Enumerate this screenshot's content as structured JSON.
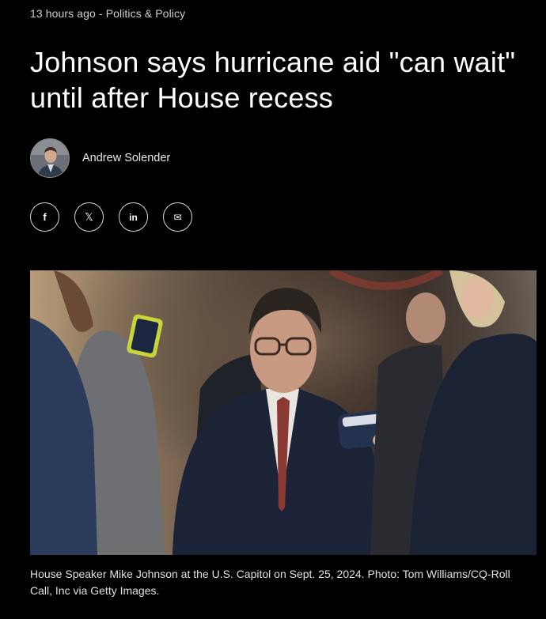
{
  "article": {
    "meta": {
      "time": "13 hours ago",
      "separator": " - ",
      "category": "Politics & Policy"
    },
    "headline": "Johnson says hurricane aid \"can wait\" until after House recess",
    "author": "Andrew Solender",
    "share": [
      {
        "icon": "facebook-icon",
        "glyph": "f"
      },
      {
        "icon": "x-icon",
        "glyph": "𝕏"
      },
      {
        "icon": "linkedin-icon",
        "glyph": "in"
      },
      {
        "icon": "email-icon",
        "glyph": "✉"
      }
    ],
    "caption": "House Speaker Mike Johnson at the U.S. Capitol on Sept. 25, 2024. Photo: Tom Williams/CQ-Roll Call, Inc via Getty Images."
  }
}
